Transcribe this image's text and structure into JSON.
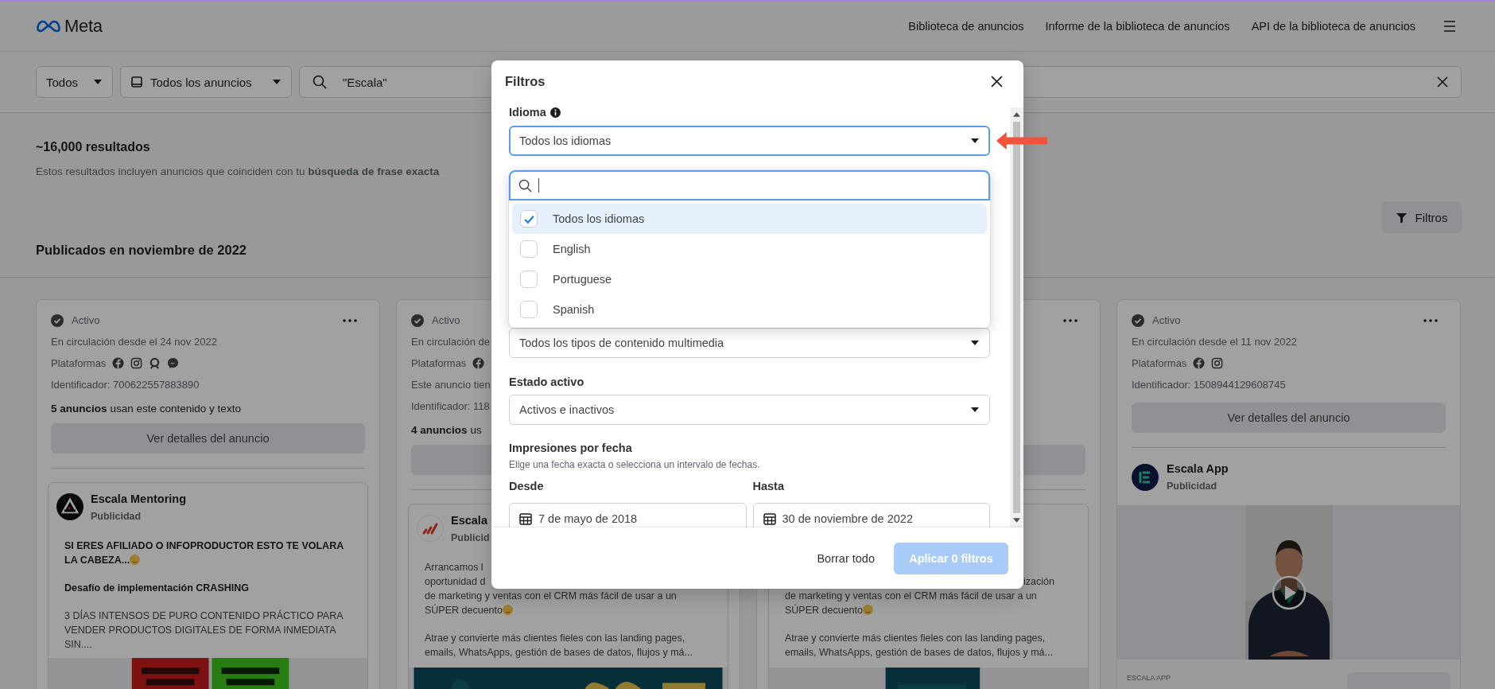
{
  "header": {
    "logo": "Meta",
    "nav": [
      {
        "label": "Biblioteca de anuncios"
      },
      {
        "label": "Informe de la biblioteca de anuncios"
      },
      {
        "label": "API de la biblioteca de anuncios"
      }
    ]
  },
  "search": {
    "country": "Todos",
    "ad_category": "Todos los anuncios",
    "query": "\"Escala\""
  },
  "results": {
    "count": "~16,000 resultados",
    "note": "Estos resultados incluyen anuncios que coinciden con tu **búsqueda de frase exacta**",
    "filters_button": "Filtros",
    "section_title": "Publicados en noviembre de 2022"
  },
  "cards": [
    {
      "more_menu": true,
      "status": "Activo",
      "since": "En circulación desde el 24 nov 2022",
      "platforms_label": "Plataformas",
      "platforms": [
        {
          "kind": "facebook"
        },
        {
          "kind": "instagram"
        },
        {
          "kind": "audience"
        },
        {
          "kind": "messenger"
        }
      ],
      "id": "Identificador: 700622557883890",
      "uses": "**5 anuncios** usan este contenido y texto",
      "details_button": "Ver detalles del anuncio",
      "advertiser": {
        "name": "Escala Mentoring",
        "label": "Publicidad"
      },
      "body": [
        {
          "lines": [
            {
              "text": "SI ERES AFILIADO O INFOPRODUCTOR ESTO TE VOLARA LA CABEZA...",
              "bold": true,
              "indented": false,
              "emoji": true
            }
          ]
        },
        {
          "lines": [
            {
              "text": "Desafío de implementación CRASHING",
              "bold": true,
              "indented": false,
              "emoji": false
            }
          ]
        },
        {
          "lines": [
            {
              "text": "3 DÍAS INTENSOS DE PURO CONTENIDO PRÁCTICO PARA VENDER PRODUCTOS DIGITALES DE FORMA INMEDIATA SIN....",
              "bold": false,
              "indented": false,
              "emoji": false
            }
          ]
        }
      ],
      "media": {
        "kind": "picture"
      }
    },
    {
      "more_menu": false,
      "status": "Activo",
      "since": "En circulación de",
      "platforms_label": "Plataformas",
      "platforms": [
        {
          "kind": "facebook"
        }
      ],
      "notice": "Este anuncio tien",
      "id": "Identificador: 118",
      "uses": "**4 anuncios** us",
      "advertiser": {
        "name": "Escala",
        "label": "Publicid"
      },
      "body": [
        {
          "lines": [
            {
              "text": "Arrancamos l",
              "bold": false,
              "indented": false,
              "emoji": false
            },
            {
              "text": "oportunidad d",
              "bold": false,
              "indented": false,
              "emoji": false
            },
            {
              "text": "de marketing y ventas con el CRM más fácil de usar a un",
              "bold": false,
              "indented": false,
              "emoji": false
            },
            {
              "text": "SÚPER decuento",
              "bold": false,
              "indented": false,
              "emoji": true
            }
          ]
        },
        {
          "lines": [
            {
              "text": "Atrae y convierte más clientes fieles con las landing pages,",
              "bold": false,
              "indented": false,
              "emoji": false
            },
            {
              "text": "emails, WhatsApps, gestión de bases de datos, flujos y má...",
              "bold": false,
              "indented": false,
              "emoji": false
            }
          ]
        }
      ],
      "media": {
        "kind": "picture"
      }
    },
    {
      "kind": "covered",
      "more_menu": true,
      "body": [
        {
          "lines": [
            {
              "text": "ización",
              "bold": false,
              "indented": true,
              "emoji": false
            },
            {
              "text": "de marketing y ventas con el CRM más fácil de usar a un",
              "bold": false,
              "indented": false,
              "emoji": false
            },
            {
              "text": "SÚPER decuento",
              "bold": false,
              "indented": false,
              "emoji": true
            }
          ]
        },
        {
          "lines": [
            {
              "text": "Atrae y convierte más clientes fieles con las landing pages,",
              "bold": false,
              "indented": false,
              "emoji": false
            },
            {
              "text": "emails, WhatsApps, gestión de bases de datos, flujos y má...",
              "bold": false,
              "indented": false,
              "emoji": false
            }
          ]
        }
      ],
      "media": {
        "kind": "picture"
      }
    },
    {
      "kind": "video",
      "more_menu": true,
      "status": "Activo",
      "since": "En circulación desde el 11 nov 2022",
      "platforms_label": "Plataformas",
      "platforms": [
        {
          "kind": "facebook"
        },
        {
          "kind": "instagram"
        }
      ],
      "id": "Identificador: 1508944129608745",
      "details_button": "Ver detalles del anuncio",
      "advertiser": {
        "name": "Escala App",
        "label": "Publicidad"
      },
      "media": {
        "kind": "picture"
      },
      "footer": "ESCALA APP"
    }
  ],
  "modal": {
    "title": "Filtros",
    "arrow_annotation": true,
    "language": {
      "label": "Idioma",
      "value": "Todos los idiomas",
      "open": true,
      "options": [
        {
          "label": "Todos los idiomas",
          "selected": true,
          "checked": true
        },
        {
          "label": "English",
          "selected": false,
          "checked": false
        },
        {
          "label": "Portuguese",
          "selected": false,
          "checked": false
        },
        {
          "label": "Spanish",
          "selected": false,
          "checked": false
        }
      ]
    },
    "media_type": {
      "value": "Todos los tipos de contenido multimedia"
    },
    "status": {
      "label": "Estado activo",
      "value": "Activos e inactivos"
    },
    "dates": {
      "label": "Impresiones por fecha",
      "hint": "Elige una fecha exacta o selecciona un intervalo de fechas.",
      "from_label": "Desde",
      "from": "7 de mayo de 2018",
      "to_label": "Hasta",
      "to": "30 de noviembre de 2022"
    },
    "clear_button": "Borrar todo",
    "apply_button": {
      "label": "Aplicar 0 filtros",
      "disabled": true
    }
  }
}
